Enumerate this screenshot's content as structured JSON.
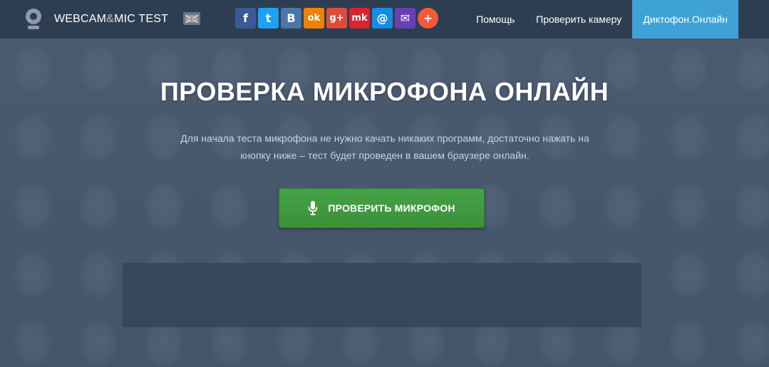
{
  "header": {
    "logo": {
      "main": "WEBCAM",
      "amp": "&",
      "rest": "MIC TEST"
    },
    "language_flag": "uk-flag-icon",
    "socials": [
      {
        "icon": "facebook-icon",
        "glyph": "f",
        "color": "#3b5998"
      },
      {
        "icon": "twitter-icon",
        "glyph": "t",
        "color": "#1da1f2"
      },
      {
        "icon": "vkontakte-icon",
        "glyph": "B",
        "color": "#4a76a8"
      },
      {
        "icon": "odnoklassniki-icon",
        "glyph": "ok",
        "color": "#ee8208"
      },
      {
        "icon": "google-plus-icon",
        "glyph": "g+",
        "color": "#dd4b39"
      },
      {
        "icon": "moi-krug-icon",
        "glyph": "mk",
        "color": "#d9232d"
      },
      {
        "icon": "mail-ru-icon",
        "glyph": "@",
        "color": "#168de2"
      },
      {
        "icon": "email-icon",
        "glyph": "✉",
        "color": "#6b3fb4"
      },
      {
        "icon": "share-plus-icon",
        "glyph": "+",
        "color": "#f05a38"
      }
    ],
    "nav": [
      {
        "label": "Помощь"
      },
      {
        "label": "Проверить камеру"
      },
      {
        "label": "Диктофон.Онлайн"
      }
    ]
  },
  "hero": {
    "title": "ПРОВЕРКА МИКРОФОНА ОНЛАЙН",
    "subtitle": "Для начала теста микрофона не нужно качать никаких программ, достаточно нажать на кнопку ниже – тест будет проведен в вашем браузере онлайн.",
    "button_label": "ПРОВЕРИТЬ МИКРОФОН"
  },
  "colors": {
    "topbar": "#2e3e52",
    "nav_active": "#3fa2d6",
    "cta_green": "#3f9a3f",
    "panel": "#35475c"
  }
}
